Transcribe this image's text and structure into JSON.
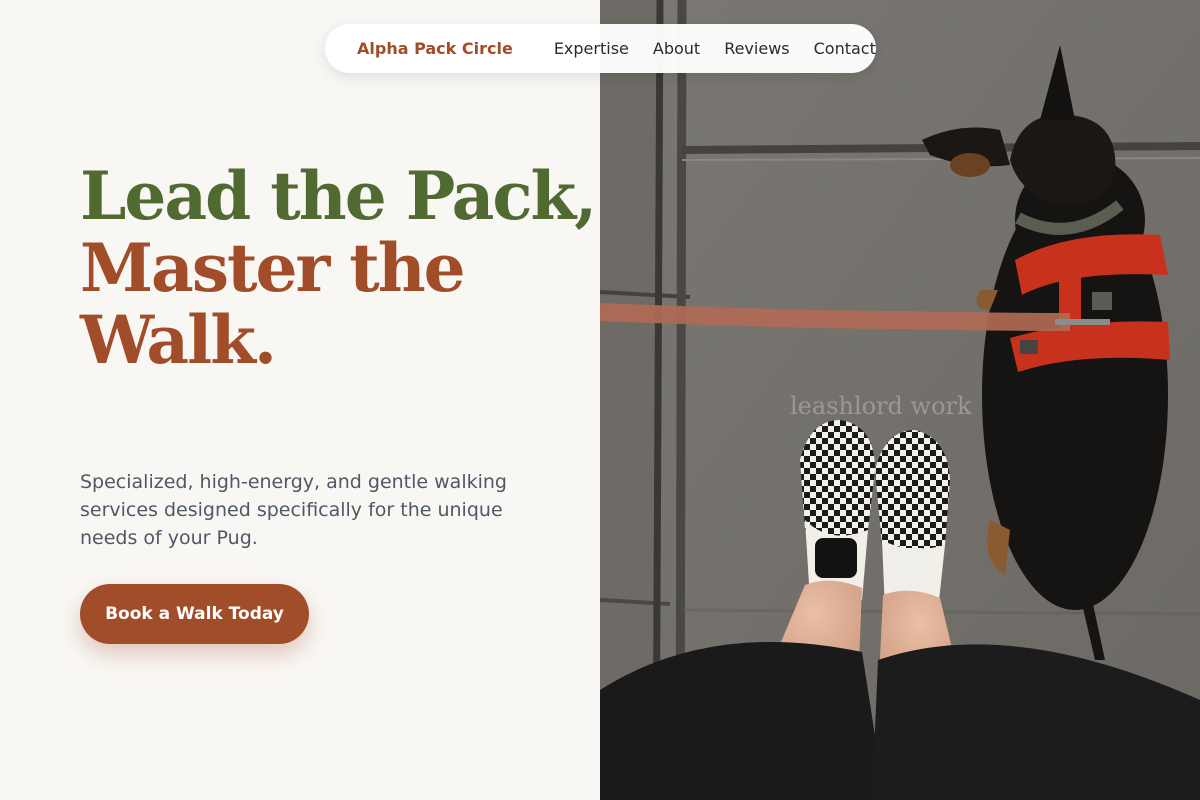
{
  "nav": {
    "brand": "Alpha Pack Circle",
    "links": [
      "Expertise",
      "About",
      "Reviews",
      "Contact"
    ]
  },
  "hero": {
    "headline_line1": "Lead the Pack,",
    "headline_line2": "Master the Walk.",
    "subtitle": "Specialized, high-energy, and gentle walking services designed specifically for the unique needs of your Pug.",
    "cta_label": "Book a Walk Today"
  },
  "photo": {
    "watermark": "leashlord work"
  },
  "colors": {
    "background": "#f9f7f4",
    "brand": "#a24d29",
    "headline_green": "#516a32",
    "headline_brown": "#a24d29",
    "body_text": "#505866",
    "nav_text": "#2b2b2b"
  }
}
